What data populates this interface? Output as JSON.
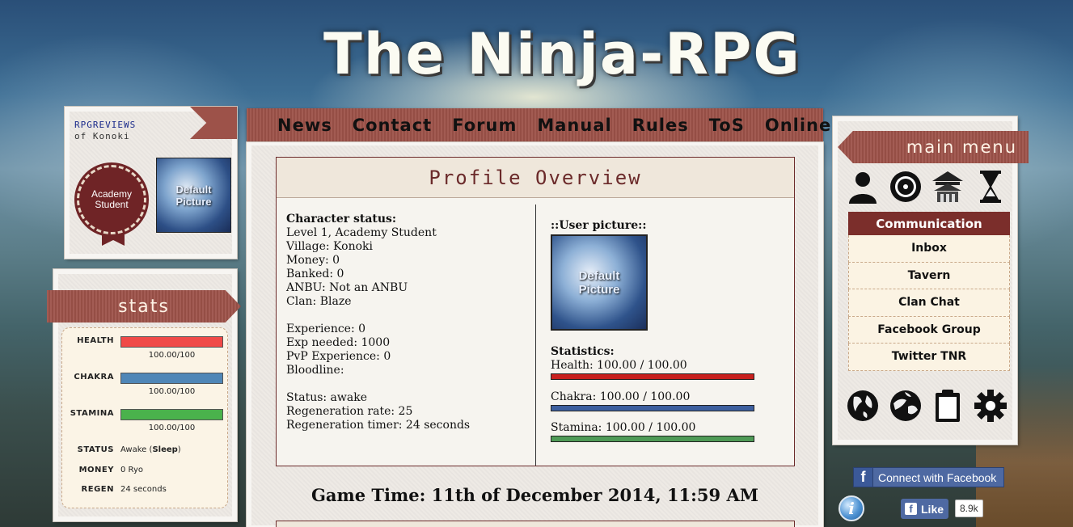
{
  "logo": {
    "text": "The Ninja-RPG"
  },
  "profile": {
    "rpgreviews_line1": "RPGREVIEWS",
    "rpgreviews_line2": "of Konoki",
    "rank_badge": "Academy Student",
    "avatar_line1": "Default",
    "avatar_line2": "Picture"
  },
  "stats": {
    "title": "stats",
    "health": {
      "label": "HEALTH",
      "value": "100.00/100",
      "fraction": 1.0,
      "color": "#f04a48"
    },
    "chakra": {
      "label": "CHAKRA",
      "value": "100.00/100",
      "fraction": 1.0,
      "color": "#4f86b7"
    },
    "stamina": {
      "label": "STAMINA",
      "value": "100.00/100",
      "fraction": 1.0,
      "color": "#4ab24c"
    },
    "status": {
      "label": "STATUS",
      "value": "Awake",
      "action": "Sleep"
    },
    "money": {
      "label": "MONEY",
      "value": "0 Ryo"
    },
    "regen": {
      "label": "REGEN",
      "value": "24 seconds"
    }
  },
  "nav": {
    "items": [
      "News",
      "Contact",
      "Forum",
      "Manual",
      "Rules",
      "ToS",
      "Online"
    ]
  },
  "overview": {
    "title": "Profile Overview",
    "left": {
      "heading": "Character status:",
      "level": "Level 1, Academy Student",
      "village": "Village: Konoki",
      "money": "Money: 0",
      "banked": "Banked: 0",
      "anbu": "ANBU: Not an ANBU",
      "clan": "Clan: Blaze",
      "experience": "Experience: 0",
      "exp_needed": "Exp needed: 1000",
      "pvp": "PvP Experience: 0",
      "bloodline": "Bloodline:",
      "status": "Status: awake",
      "regen_rate": "Regeneration rate: 25",
      "regen_timer": "Regeneration timer: 24 seconds"
    },
    "right": {
      "user_picture": "::User picture::",
      "pic_line1": "Default",
      "pic_line2": "Picture",
      "statistics": "Statistics:",
      "health": {
        "text": "Health: 100.00 / 100.00",
        "fraction": 1.0,
        "color": "#c8201e"
      },
      "chakra": {
        "text": "Chakra: 100.00 / 100.00",
        "fraction": 1.0,
        "color": "#3d5f9e"
      },
      "stamina": {
        "text": "Stamina: 100.00 / 100.00",
        "fraction": 1.0,
        "color": "#4e9a56"
      }
    }
  },
  "game_time": "Game Time: 11th of December 2014, 11:59 AM",
  "menu": {
    "title": "main menu",
    "top_icons": [
      "user-icon",
      "target-icon",
      "temple-icon",
      "hourglass-icon"
    ],
    "section": "Communication",
    "items": [
      "Inbox",
      "Tavern",
      "Clan Chat",
      "Facebook Group",
      "Twitter TNR"
    ],
    "bottom_icons": [
      "globe-icon",
      "world-map-icon",
      "clipboard-icon",
      "gear-icon"
    ]
  },
  "facebook": {
    "connect": "Connect with Facebook",
    "like": "Like",
    "count": "8.9k"
  }
}
